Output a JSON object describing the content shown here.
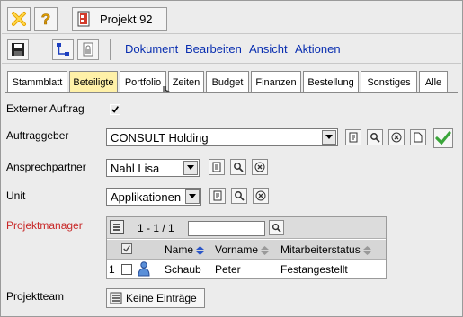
{
  "title_bar": {
    "project_label": "Projekt 92"
  },
  "menu": [
    "Dokument",
    "Bearbeiten",
    "Ansicht",
    "Aktionen"
  ],
  "tabs": [
    {
      "label": "Stammblatt"
    },
    {
      "label": "Beteiligte",
      "active": true
    },
    {
      "label": "Portfolio"
    },
    {
      "label": "Zeiten"
    },
    {
      "label": "Budget"
    },
    {
      "label": "Finanzen"
    },
    {
      "label": "Bestellung"
    },
    {
      "label": "Sonstiges"
    },
    {
      "label": "Alle"
    }
  ],
  "form": {
    "externer_auftrag": {
      "label": "Externer Auftrag",
      "checked": true
    },
    "auftraggeber": {
      "label": "Auftraggeber",
      "value": "CONSULT Holding"
    },
    "ansprechpartner": {
      "label": "Ansprechpartner",
      "value": "Nahl Lisa"
    },
    "unit": {
      "label": "Unit",
      "value": "Applikationen"
    },
    "projektmanager": {
      "label": "Projektmanager",
      "pager": "1 - 1 / 1",
      "columns": [
        "Name",
        "Vorname",
        "Mitarbeiterstatus"
      ],
      "rows": [
        {
          "index": "1",
          "name": "Schaub",
          "vorname": "Peter",
          "status": "Festangestellt"
        }
      ]
    },
    "projektteam": {
      "label": "Projektteam",
      "button": "Keine Einträge"
    }
  },
  "colors": {
    "active_tab": "#fff1a8",
    "menu_link": "#0a2fb0",
    "required_label": "#c82828",
    "confirm_green": "#3aa53a"
  }
}
